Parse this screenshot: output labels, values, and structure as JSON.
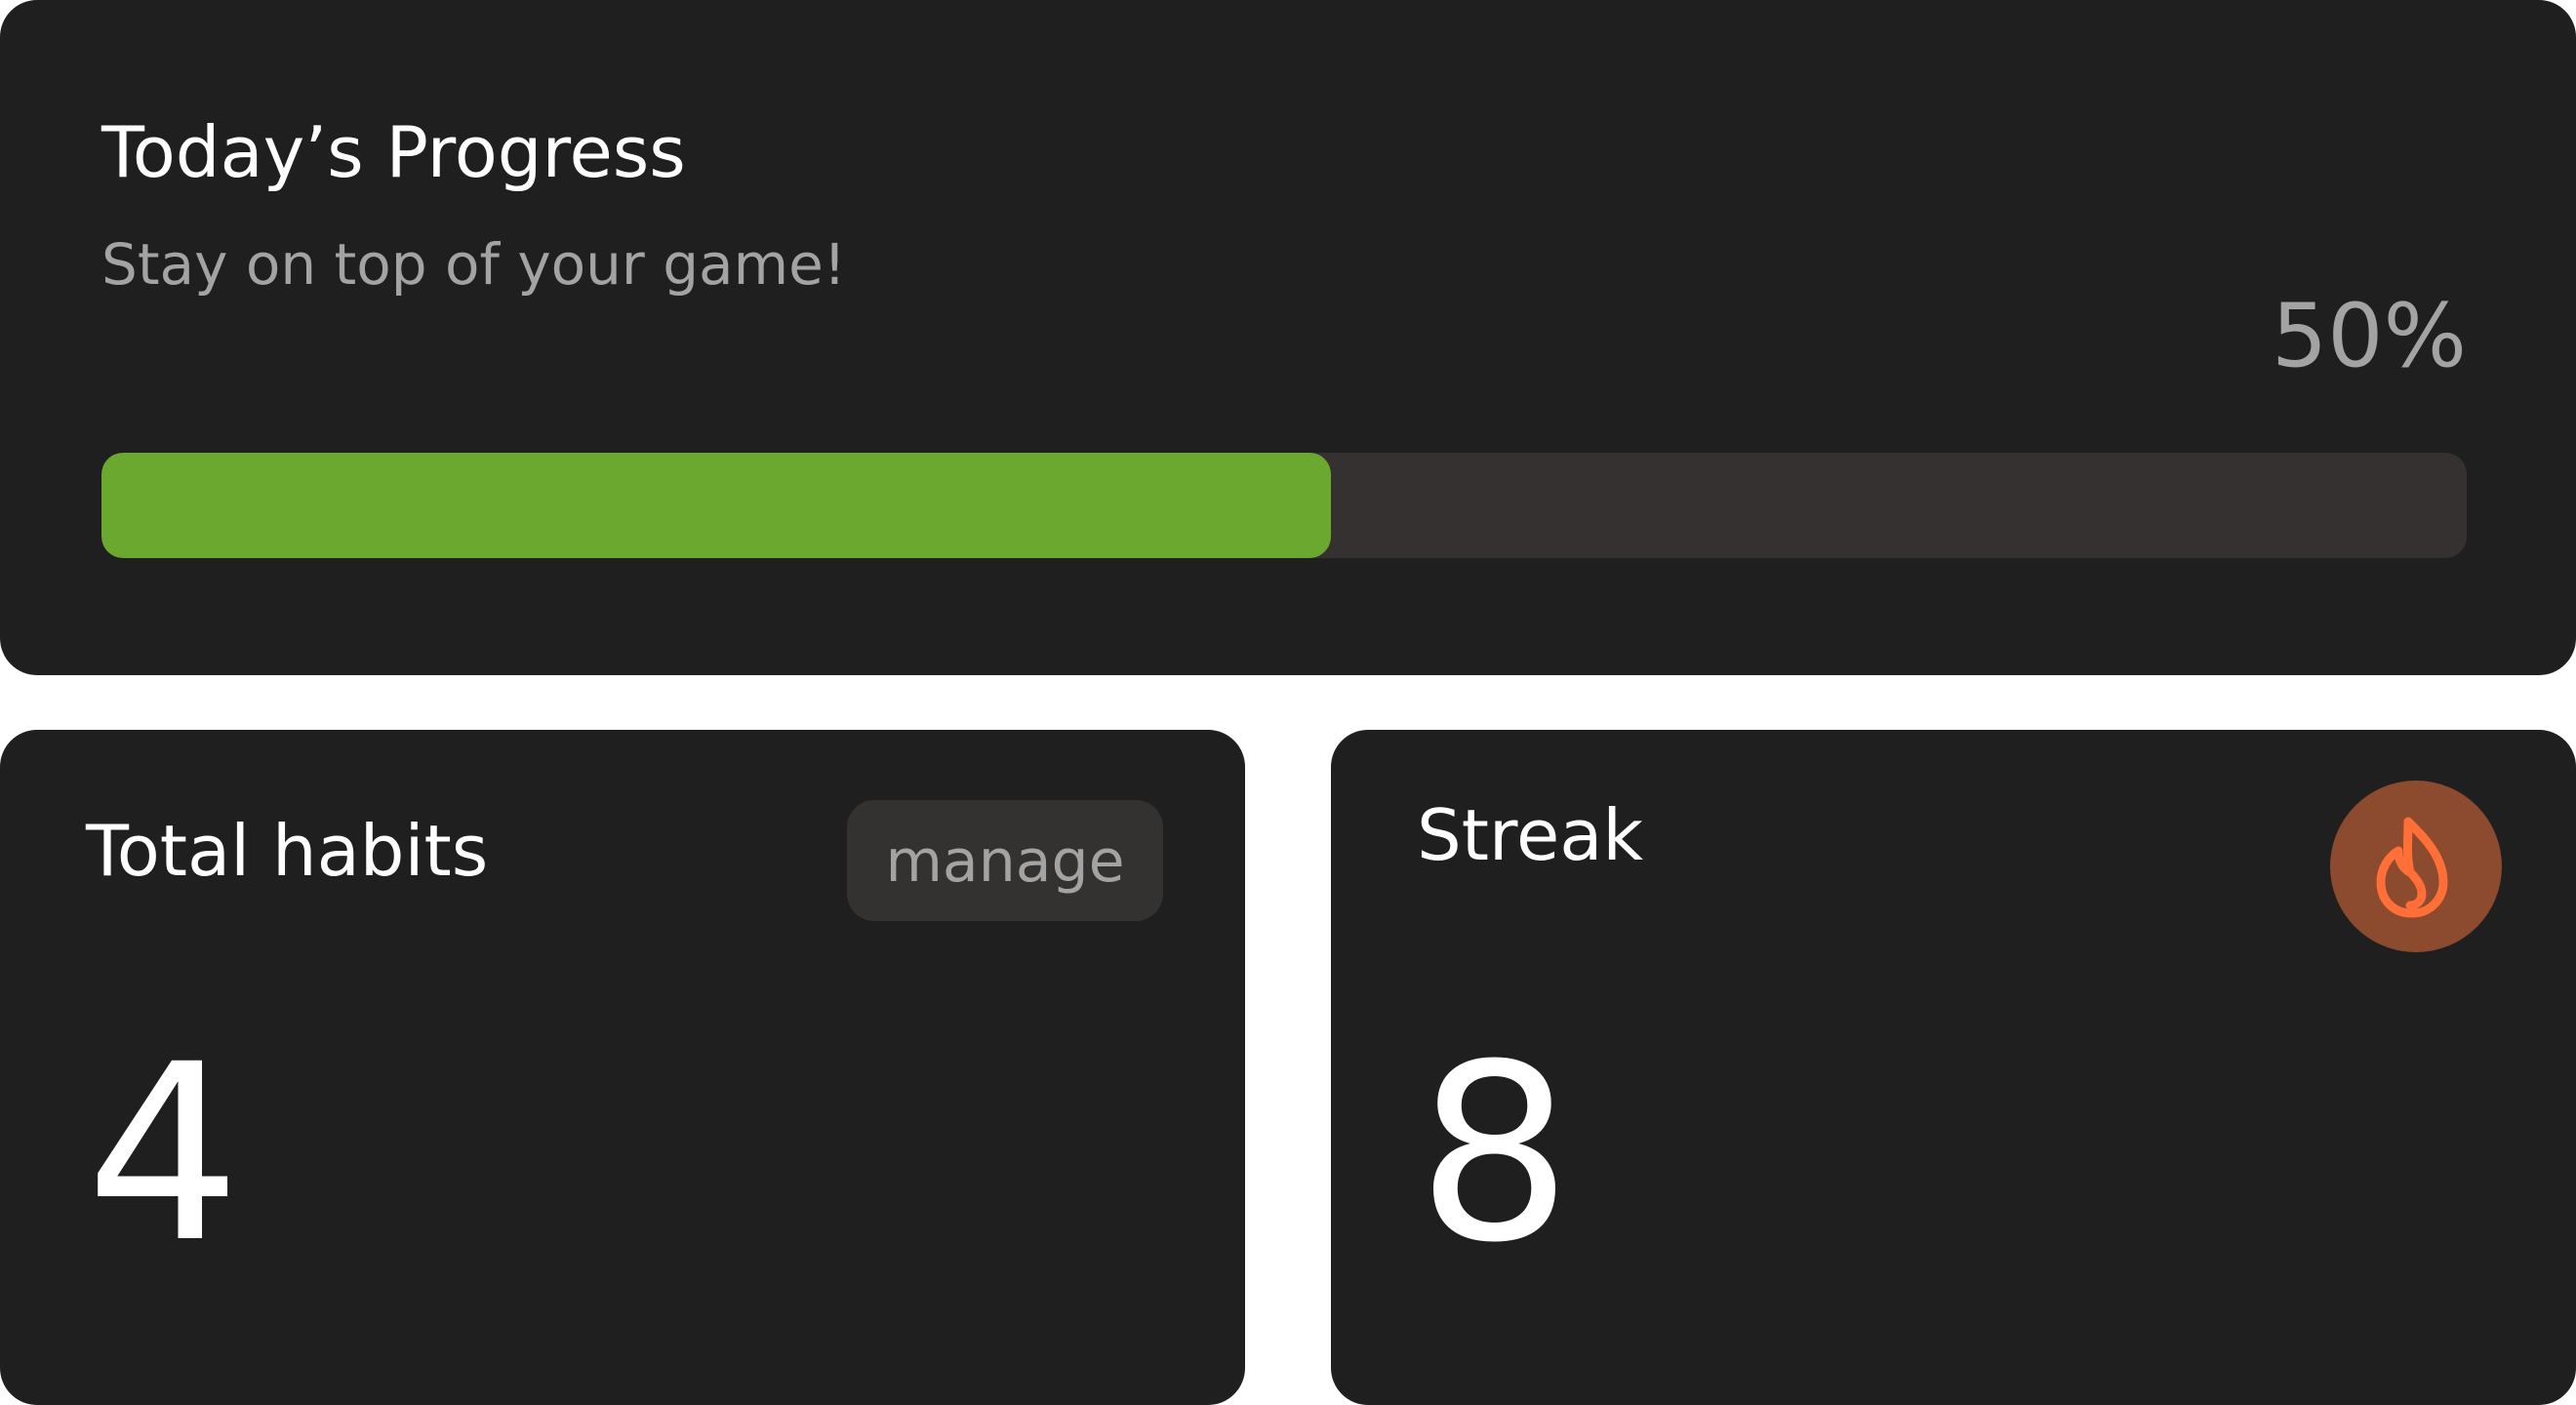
{
  "progress": {
    "title": "Today’s Progress",
    "subtitle": "Stay on top of your game!",
    "percent_label": "50%",
    "progress_fraction": 0.52,
    "fill_color": "#6aa82f",
    "track_color": "#353131"
  },
  "habits": {
    "title": "Total habits",
    "manage_label": "manage",
    "count": "4"
  },
  "streak": {
    "title": "Streak",
    "count": "8",
    "icon": "flame-icon",
    "icon_color": "#ff6f37",
    "badge_color": "#8c4a2f"
  }
}
